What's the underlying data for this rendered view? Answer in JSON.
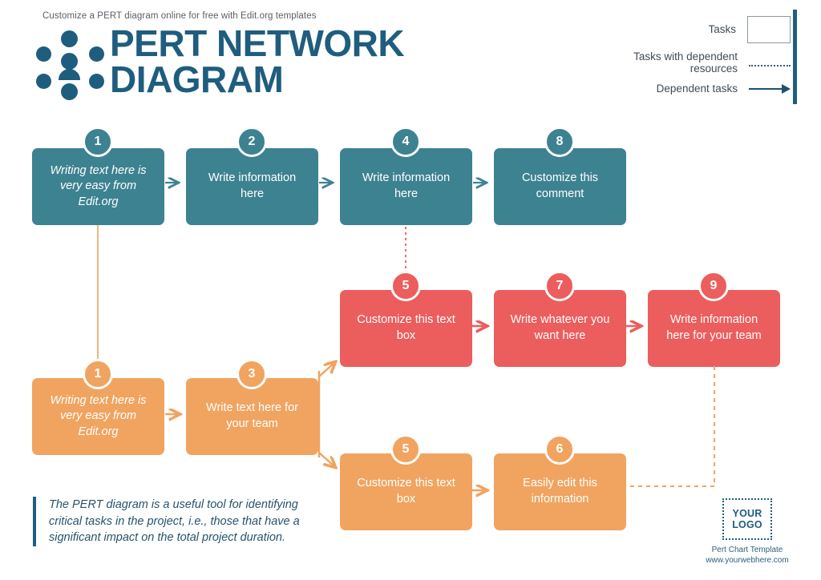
{
  "header": {
    "tagline": "Customize a PERT diagram online for free with Edit.org templates",
    "title_line1": "PERT NETWORK",
    "title_line2": "DIAGRAM",
    "brand_color": "#1f5d7e"
  },
  "legend": {
    "items": [
      {
        "label": "Tasks",
        "swatch": "box-outline"
      },
      {
        "label": "Tasks with dependent resources",
        "swatch": "dotted-line"
      },
      {
        "label": "Dependent tasks",
        "swatch": "arrow"
      }
    ]
  },
  "colors": {
    "teal": "#3d8291",
    "red": "#ec5d5d",
    "orange": "#f0a460",
    "navy": "#1f5d7e"
  },
  "nodes": [
    {
      "id": "t1",
      "number": "1",
      "text": "Writing text here is very easy from Edit.org",
      "color": "teal",
      "italic": true
    },
    {
      "id": "t2",
      "number": "2",
      "text": "Write information here",
      "color": "teal",
      "italic": false
    },
    {
      "id": "t4",
      "number": "4",
      "text": "Write information here",
      "color": "teal",
      "italic": false
    },
    {
      "id": "t8",
      "number": "8",
      "text": "Customize this comment",
      "color": "teal",
      "italic": false
    },
    {
      "id": "r5",
      "number": "5",
      "text": "Customize this text box",
      "color": "red",
      "italic": false
    },
    {
      "id": "r7",
      "number": "7",
      "text": "Write whatever you want here",
      "color": "red",
      "italic": false
    },
    {
      "id": "r9",
      "number": "9",
      "text": "Write information here for your team",
      "color": "red",
      "italic": false
    },
    {
      "id": "o1",
      "number": "1",
      "text": "Writing text here is very easy from Edit.org",
      "color": "orange",
      "italic": true
    },
    {
      "id": "o3",
      "number": "3",
      "text": "Write text here for your team",
      "color": "orange",
      "italic": false
    },
    {
      "id": "o5",
      "number": "5",
      "text": "Customize this text box",
      "color": "orange",
      "italic": false
    },
    {
      "id": "o6",
      "number": "6",
      "text": "Easily edit this information",
      "color": "orange",
      "italic": false
    }
  ],
  "quote": {
    "text": "The PERT diagram is a useful tool for identifying critical tasks in the project, i.e., those that have a significant impact on the total project duration."
  },
  "footer": {
    "logo_line1": "YOUR",
    "logo_line2": "LOGO",
    "caption": "Pert Chart Template",
    "website": "www.yourwebhere.com"
  }
}
